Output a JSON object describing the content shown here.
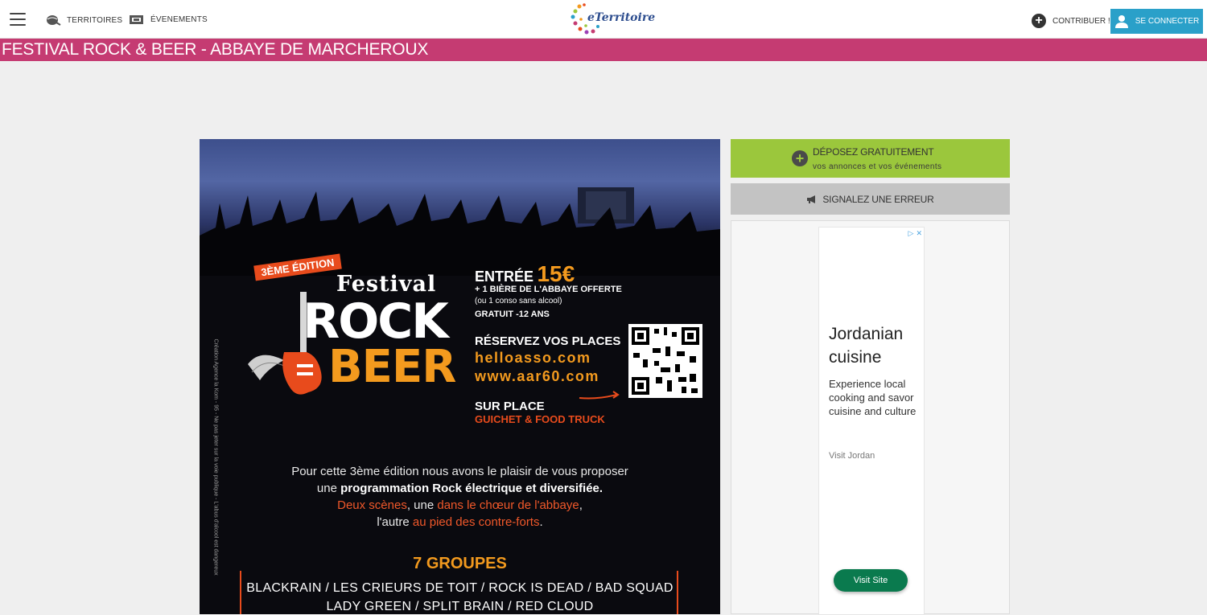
{
  "nav": {
    "territoires": "TERRITOIRES",
    "evenements": "ÉVENEMENTS",
    "logo": "eTerritoire",
    "contribuer": "CONTRIBUER !",
    "connect": "SE CONNECTER"
  },
  "page": {
    "title": "FESTIVAL ROCK & BEER - ABBAYE DE MARCHEROUX"
  },
  "poster": {
    "edition": "3ÈME ÉDITION",
    "festival": "Festival",
    "rock": "ROCK",
    "beer": "BEER",
    "entree_label": "ENTRÉE",
    "entree_price": "15€",
    "line_biere": "+ 1 BIÈRE DE L'ABBAYE OFFERTE",
    "line_conso": "(ou 1 conso sans alcool)",
    "line_gratuit": "GRATUIT -12 ANS",
    "reservez": "RÉSERVEZ VOS PLACES",
    "url1": "helloasso.com",
    "url2": "www.aar60.com",
    "sur_place": "SUR PLACE",
    "guichet": "GUICHET & FOOD TRUCK",
    "credit": "Création Agence la Kom - 95 - Ne pas jeter sur la voie publique - L'abus d'alcool est dangereux",
    "desc_1": "Pour cette 3ème édition nous avons le plaisir de vous proposer",
    "desc_2a": "une ",
    "desc_2b": "programmation Rock électrique et diversifiée.",
    "desc_3a": "Deux scènes",
    "desc_3b": ", une ",
    "desc_3c": "dans le chœur de l'abbaye",
    "desc_3d": ",",
    "desc_4a": "l'autre ",
    "desc_4b": "au pied des contre-forts",
    "desc_4c": ".",
    "groupes_title": "7 GROUPES",
    "groupes_1": "BLACKRAIN / LES CRIEURS DE TOIT / ROCK IS DEAD / BAD SQUAD",
    "groupes_2": "LADY GREEN / SPLIT BRAIN / RED CLOUD"
  },
  "sidebar": {
    "deposez_main": "DÉPOSEZ GRATUITEMENT",
    "deposez_sub": "vos annonces et vos événements",
    "signalez": "SIGNALEZ UNE ERREUR"
  },
  "ad": {
    "headline": "Jordanian cuisine",
    "body": "Experience local cooking and savor cuisine and culture",
    "brand": "Visit Jordan",
    "cta": "Visit Site"
  },
  "colors": {
    "title_bar": "#c53b72",
    "connect_button": "#2aa0c9",
    "deposez": "#9bc73c",
    "signalez": "#c3c3c3",
    "ad_cta": "#0a7a4e"
  },
  "icons": {
    "menu": "hamburger-icon",
    "territoires": "globe-icon",
    "evenements": "ticket-icon",
    "contribuer": "plus-circle-icon",
    "connect": "user-icon",
    "signalez": "megaphone-icon"
  }
}
